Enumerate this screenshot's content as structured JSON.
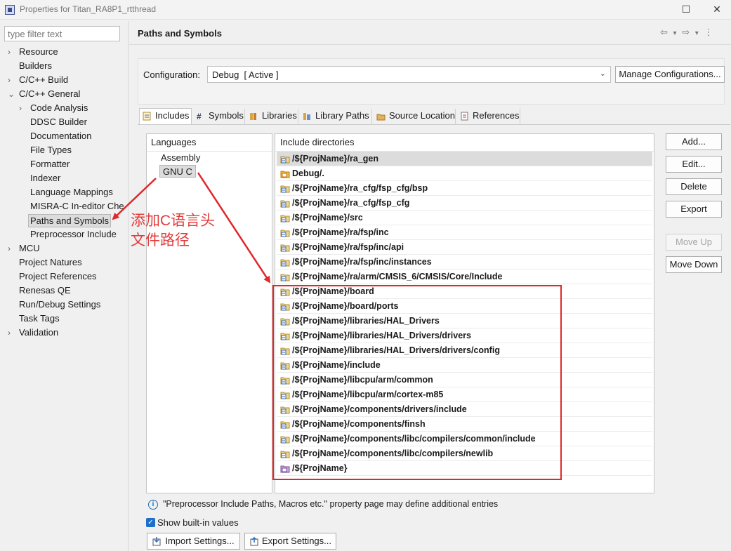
{
  "window": {
    "title": "Properties for Titan_RA8P1_rtthread",
    "maximize_glyph": "☐",
    "close_glyph": "✕"
  },
  "filter": {
    "placeholder": "type filter text"
  },
  "tree": [
    {
      "label": "Resource",
      "level": 0,
      "expander": "›"
    },
    {
      "label": "Builders",
      "level": 0,
      "expander": ""
    },
    {
      "label": "C/C++ Build",
      "level": 0,
      "expander": "›"
    },
    {
      "label": "C/C++ General",
      "level": 0,
      "expander": "⌄"
    },
    {
      "label": "Code Analysis",
      "level": 1,
      "expander": "›"
    },
    {
      "label": "DDSC Builder",
      "level": 1,
      "expander": ""
    },
    {
      "label": "Documentation",
      "level": 1,
      "expander": ""
    },
    {
      "label": "File Types",
      "level": 1,
      "expander": ""
    },
    {
      "label": "Formatter",
      "level": 1,
      "expander": ""
    },
    {
      "label": "Indexer",
      "level": 1,
      "expander": ""
    },
    {
      "label": "Language Mappings",
      "level": 1,
      "expander": ""
    },
    {
      "label": "MISRA-C In-editor Che",
      "level": 1,
      "expander": ""
    },
    {
      "label": "Paths and Symbols",
      "level": 1,
      "expander": "",
      "selected": true
    },
    {
      "label": "Preprocessor Include",
      "level": 1,
      "expander": ""
    },
    {
      "label": "MCU",
      "level": 0,
      "expander": "›"
    },
    {
      "label": "Project Natures",
      "level": 0,
      "expander": ""
    },
    {
      "label": "Project References",
      "level": 0,
      "expander": ""
    },
    {
      "label": "Renesas QE",
      "level": 0,
      "expander": ""
    },
    {
      "label": "Run/Debug Settings",
      "level": 0,
      "expander": ""
    },
    {
      "label": "Task Tags",
      "level": 0,
      "expander": ""
    },
    {
      "label": "Validation",
      "level": 0,
      "expander": "›"
    }
  ],
  "page": {
    "title": "Paths and Symbols",
    "nav": {
      "back": "⇦",
      "menu1": "▾",
      "forward": "⇨",
      "menu2": "▾",
      "more": "⋮"
    }
  },
  "config": {
    "label": "Configuration:",
    "value": "Debug  [ Active ]",
    "dropdown_glyph": "⌄",
    "manage_label": "Manage Configurations..."
  },
  "tabs": [
    {
      "label": "Includes",
      "active": true,
      "icon": "includes-icon"
    },
    {
      "label": "Symbols",
      "icon": "hash-icon"
    },
    {
      "label": "Libraries",
      "icon": "libraries-icon"
    },
    {
      "label": "Library Paths",
      "icon": "library-paths-icon"
    },
    {
      "label": "Source Location",
      "icon": "source-location-icon"
    },
    {
      "label": "References",
      "icon": "references-icon"
    }
  ],
  "languages": {
    "header": "Languages",
    "items": [
      {
        "label": "Assembly"
      },
      {
        "label": "GNU C",
        "selected": true
      }
    ]
  },
  "includes": {
    "header": "Include directories",
    "rows": [
      {
        "path": "/${ProjName}/ra_gen",
        "icon": "include-folder-icon",
        "selected": true
      },
      {
        "path": "Debug/.",
        "icon": "folder-orange-icon"
      },
      {
        "path": "/${ProjName}/ra_cfg/fsp_cfg/bsp",
        "icon": "include-folder-icon"
      },
      {
        "path": "/${ProjName}/ra_cfg/fsp_cfg",
        "icon": "include-folder-icon"
      },
      {
        "path": "/${ProjName}/src",
        "icon": "include-folder-icon"
      },
      {
        "path": "/${ProjName}/ra/fsp/inc",
        "icon": "include-folder-icon"
      },
      {
        "path": "/${ProjName}/ra/fsp/inc/api",
        "icon": "include-folder-icon"
      },
      {
        "path": "/${ProjName}/ra/fsp/inc/instances",
        "icon": "include-folder-icon"
      },
      {
        "path": "/${ProjName}/ra/arm/CMSIS_6/CMSIS/Core/Include",
        "icon": "include-folder-icon"
      },
      {
        "path": "/${ProjName}/board",
        "icon": "include-folder-icon"
      },
      {
        "path": "/${ProjName}/board/ports",
        "icon": "include-folder-icon"
      },
      {
        "path": "/${ProjName}/libraries/HAL_Drivers",
        "icon": "include-folder-icon"
      },
      {
        "path": "/${ProjName}/libraries/HAL_Drivers/drivers",
        "icon": "include-folder-icon"
      },
      {
        "path": "/${ProjName}/libraries/HAL_Drivers/drivers/config",
        "icon": "include-folder-icon"
      },
      {
        "path": "/${ProjName}/include",
        "icon": "include-folder-icon"
      },
      {
        "path": "/${ProjName}/libcpu/arm/common",
        "icon": "include-folder-icon"
      },
      {
        "path": "/${ProjName}/libcpu/arm/cortex-m85",
        "icon": "include-folder-icon"
      },
      {
        "path": "/${ProjName}/components/drivers/include",
        "icon": "include-folder-icon"
      },
      {
        "path": "/${ProjName}/components/finsh",
        "icon": "include-folder-icon"
      },
      {
        "path": "/${ProjName}/components/libc/compilers/common/include",
        "icon": "include-folder-icon"
      },
      {
        "path": "/${ProjName}/components/libc/compilers/newlib",
        "icon": "include-folder-icon"
      },
      {
        "path": "/${ProjName}",
        "icon": "project-icon"
      }
    ]
  },
  "side_buttons": {
    "add": "Add...",
    "edit": "Edit...",
    "delete": "Delete",
    "export": "Export",
    "move_up": "Move Up",
    "move_down": "Move Down"
  },
  "annotation": {
    "line1": "添加C语言头",
    "line2": "文件路径",
    "color": "#e33b3b"
  },
  "footer": {
    "info_glyph": "i",
    "info_text": "\"Preprocessor Include Paths, Macros etc.\" property page may define additional entries",
    "show_builtin_label": "Show built-in values",
    "show_builtin_checked": true,
    "check_glyph": "✓",
    "import_label": "Import Settings...",
    "export_label": "Export Settings..."
  }
}
